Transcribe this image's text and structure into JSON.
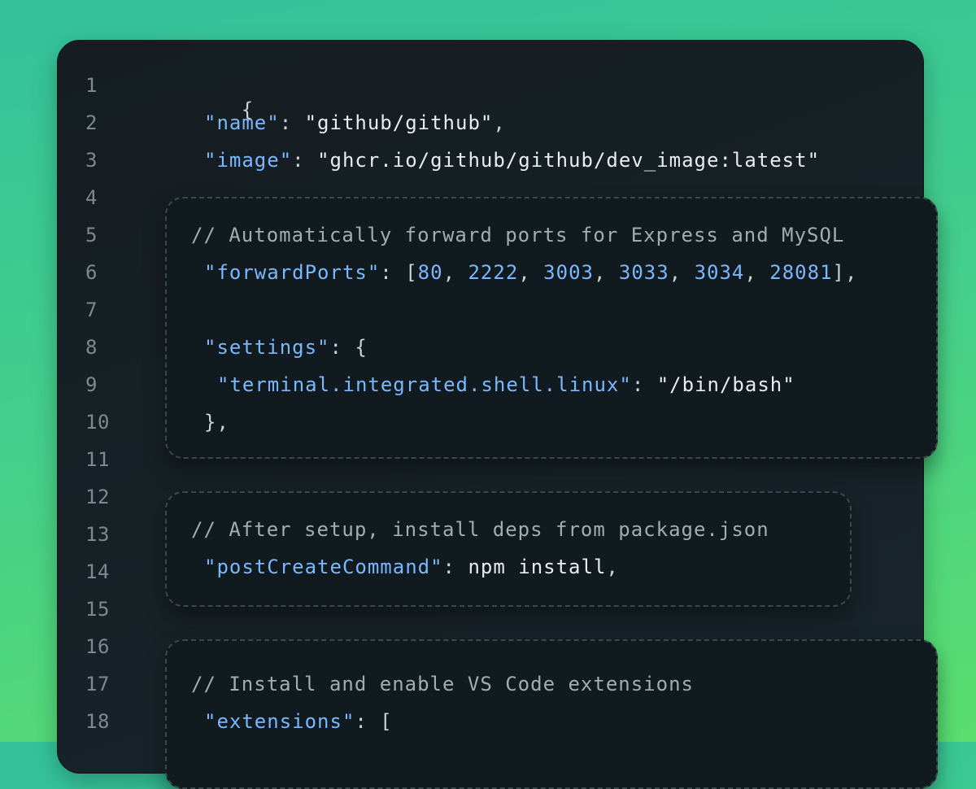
{
  "line_numbers": [
    "1",
    "2",
    "3",
    "4",
    "5",
    "6",
    "7",
    "8",
    "9",
    "10",
    "11",
    "12",
    "13",
    "14",
    "15",
    "16",
    "17",
    "18"
  ],
  "top": {
    "line1": "{",
    "name_key": "\"name\"",
    "name_colon": ": ",
    "name_value": "\"github/github\"",
    "name_comma": ",",
    "image_key": "\"image\"",
    "image_colon": ": ",
    "image_value": "\"ghcr.io/github/github/dev_image:latest\""
  },
  "block_ports": {
    "comment": "// Automatically forward ports for Express and MySQL",
    "key": "\"forwardPorts\"",
    "colon_bracket": ": [",
    "ports": [
      "80",
      "2222",
      "3003",
      "3033",
      "3034",
      "28081"
    ],
    "close": "],",
    "settings_key": "\"settings\"",
    "settings_open": ": {",
    "shell_key": "\"terminal.integrated.shell.linux\"",
    "shell_colon": ": ",
    "shell_value": "\"/bin/bash\"",
    "settings_close": "},"
  },
  "block_post": {
    "comment": "// After setup, install deps from package.json",
    "key": "\"postCreateCommand\"",
    "colon": ": ",
    "value": "npm install",
    "comma": ","
  },
  "block_ext": {
    "comment": "// Install and enable VS Code extensions",
    "key": "\"extensions\"",
    "open": ": ["
  },
  "colors": {
    "key": "#79b8ff",
    "text": "#e6edf3",
    "comment": "#a3acb5",
    "line_number": "#7d8891",
    "editor_bg": "#151d21",
    "block_bg": "#111a1e"
  }
}
